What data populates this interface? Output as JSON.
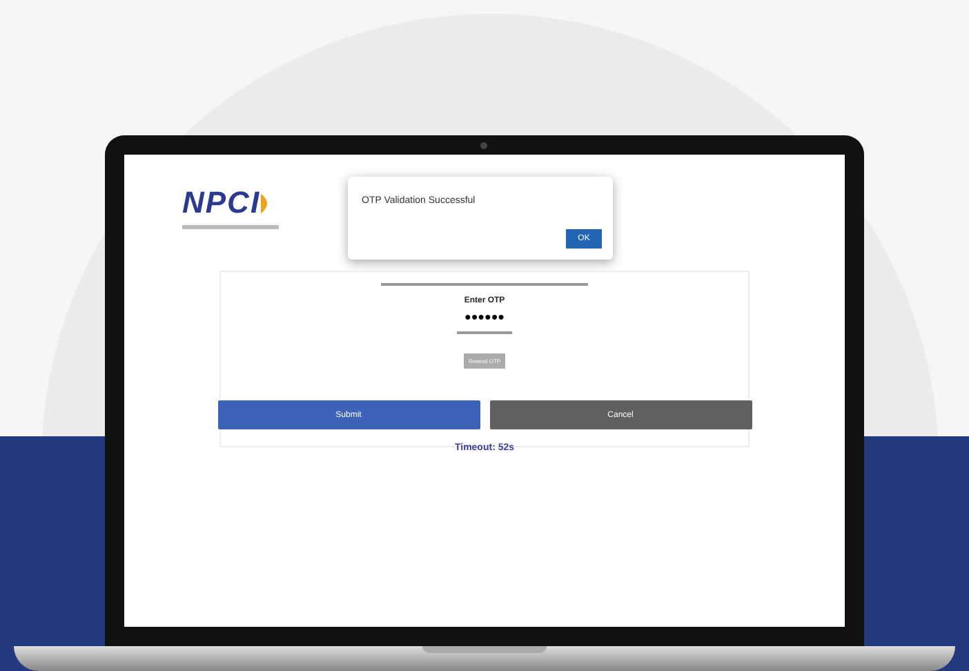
{
  "logo": {
    "text": "NPCI"
  },
  "dialog": {
    "message": "OTP Validation Successful",
    "button": "OK"
  },
  "form": {
    "label": "Enter OTP",
    "value": "●●●●●●",
    "resend_button": "Resend OTP",
    "resend_disabled": true,
    "buttons": [
      {
        "label": "Submit",
        "kind": "primary"
      },
      {
        "label": "Cancel",
        "kind": "secondary"
      }
    ],
    "timeout": "Timeout: 52s"
  }
}
